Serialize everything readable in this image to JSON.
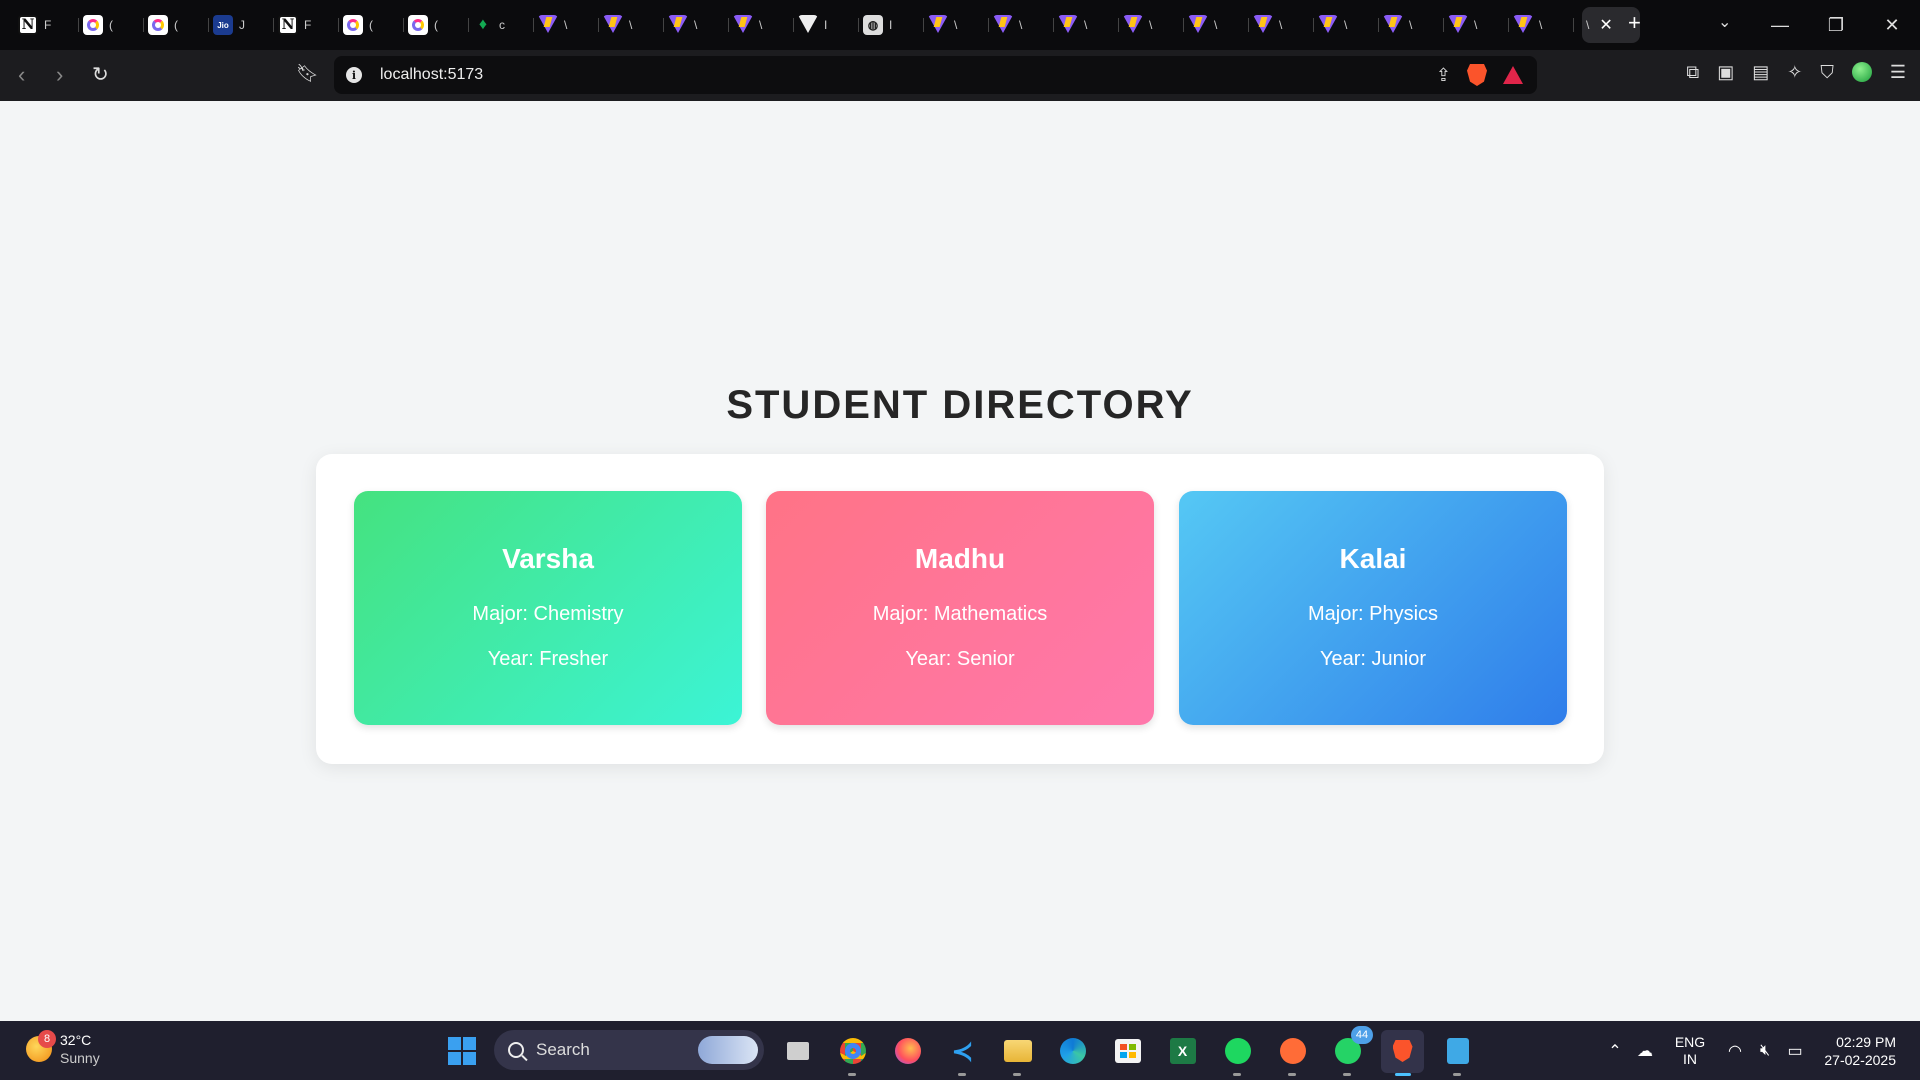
{
  "browser": {
    "tabs": [
      {
        "icon": "notion-icon",
        "title": "F"
      },
      {
        "icon": "clickup-icon",
        "title": "("
      },
      {
        "icon": "clickup-icon",
        "title": "("
      },
      {
        "icon": "jio-icon",
        "title": "J"
      },
      {
        "icon": "notion-icon",
        "title": "F"
      },
      {
        "icon": "clickup-icon",
        "title": "("
      },
      {
        "icon": "clickup-icon",
        "title": "("
      },
      {
        "icon": "mongodb-icon",
        "title": "c"
      },
      {
        "icon": "vite-icon",
        "title": "\\"
      },
      {
        "icon": "vite-icon",
        "title": "\\"
      },
      {
        "icon": "vite-icon",
        "title": "\\"
      },
      {
        "icon": "vite-icon",
        "title": "\\"
      },
      {
        "icon": "vercel-icon",
        "title": "I"
      },
      {
        "icon": "globe-icon",
        "title": "I"
      },
      {
        "icon": "vite-icon",
        "title": "\\"
      },
      {
        "icon": "vite-icon",
        "title": "\\"
      },
      {
        "icon": "vite-icon",
        "title": "\\"
      },
      {
        "icon": "vite-icon",
        "title": "\\"
      },
      {
        "icon": "vite-icon",
        "title": "\\"
      },
      {
        "icon": "vite-icon",
        "title": "\\"
      },
      {
        "icon": "vite-icon",
        "title": "\\"
      },
      {
        "icon": "vite-icon",
        "title": "\\"
      },
      {
        "icon": "vite-icon",
        "title": "\\"
      },
      {
        "icon": "vite-icon",
        "title": "\\"
      }
    ],
    "active_tab_title": "\\",
    "url": "localhost:5173"
  },
  "page": {
    "title": "STUDENT DIRECTORY",
    "students": [
      {
        "name": "Varsha",
        "major": "Major: Chemistry",
        "year": "Year: Fresher"
      },
      {
        "name": "Madhu",
        "major": "Major: Mathematics",
        "year": "Year: Senior"
      },
      {
        "name": "Kalai",
        "major": "Major: Physics",
        "year": "Year: Junior"
      }
    ]
  },
  "taskbar": {
    "weather": {
      "temp": "32°C",
      "condition": "Sunny",
      "badge": "8"
    },
    "search_label": "Search",
    "whatsapp_badge": "44",
    "lang_top": "ENG",
    "lang_bottom": "IN",
    "time": "02:29 PM",
    "date": "27-02-2025"
  },
  "colors": {
    "card_green": "#45e27f",
    "card_pink": "#ff7386",
    "card_blue": "#2f7dea"
  }
}
